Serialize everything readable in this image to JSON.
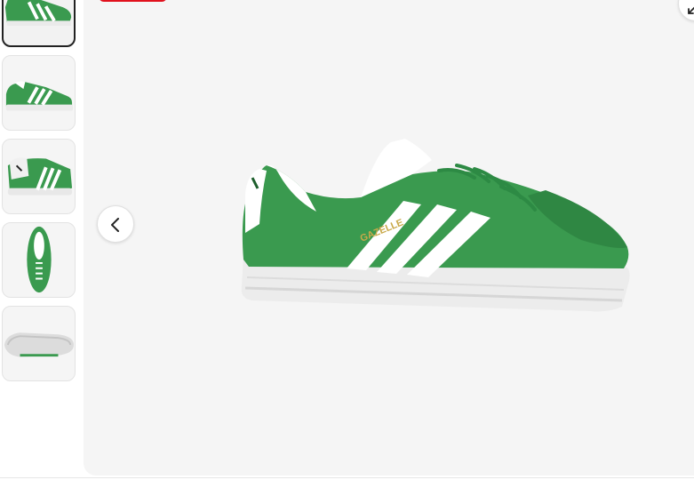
{
  "gallery": {
    "brand_green": "#3a9a4f",
    "badge_color": "#e1111d",
    "thumbnails": [
      {
        "view": "side-crop",
        "active": true
      },
      {
        "view": "side"
      },
      {
        "view": "rear-three-quarter"
      },
      {
        "view": "top"
      },
      {
        "view": "sole"
      }
    ],
    "main_image": {
      "view": "side",
      "shoe_text": "GAZELLE"
    },
    "controls": {
      "prev_icon": "chevron-left-icon",
      "expand_icon": "expand-icon"
    }
  }
}
